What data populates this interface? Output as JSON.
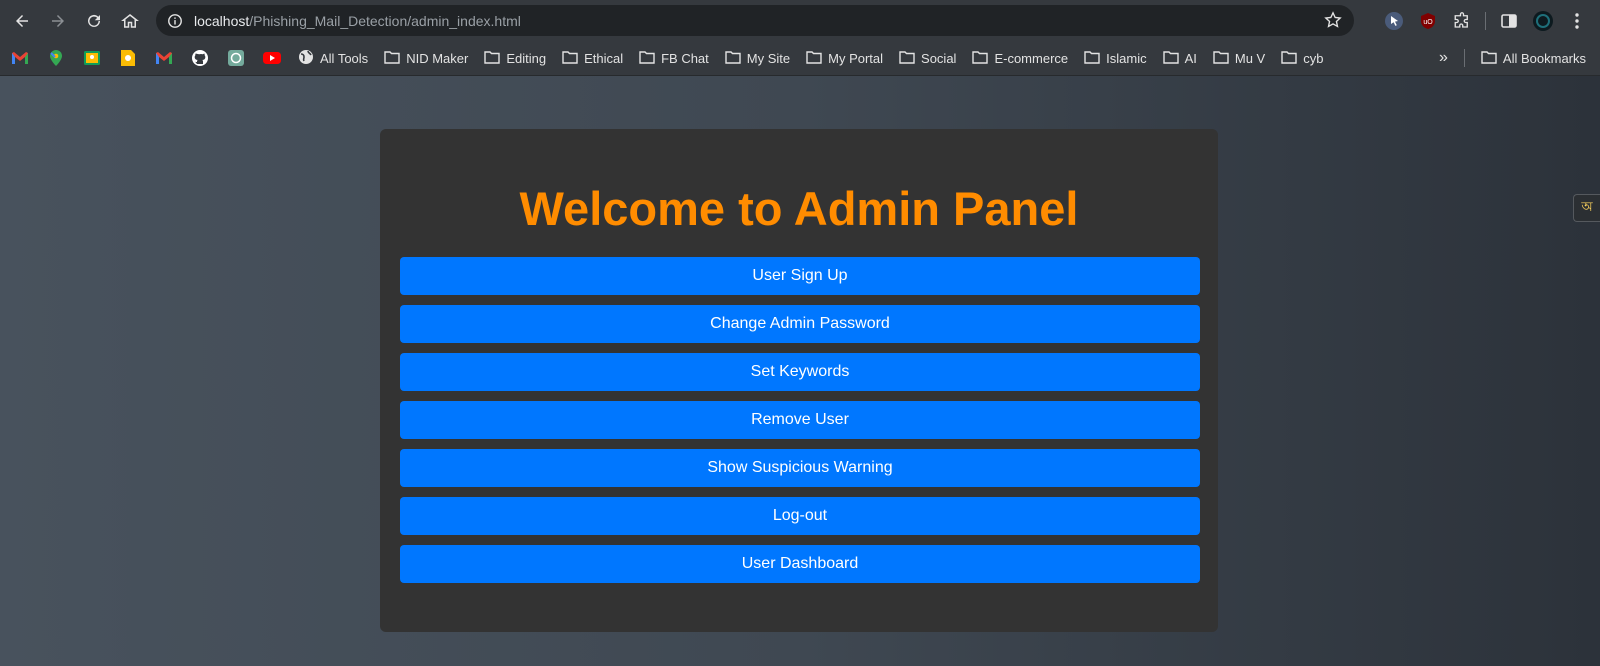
{
  "browser": {
    "url_host": "localhost",
    "url_path": "/Phishing_Mail_Detection/admin_index.html",
    "icons": {
      "back": "back-arrow-icon",
      "forward": "forward-arrow-icon",
      "reload": "reload-icon",
      "home": "home-icon",
      "site_info": "site-info-icon",
      "bookmark_star": "star-icon"
    },
    "extensions": [
      "cursor-extension-icon",
      "ublock-icon",
      "puzzle-extensions-icon",
      "side-panel-icon",
      "profile-avatar-icon",
      "kebab-menu-icon"
    ]
  },
  "bookmarks": {
    "app_icons": [
      "gmail-icon",
      "maps-icon",
      "classroom-icon",
      "keep-icon",
      "gmail-icon",
      "github-icon",
      "chatgpt-icon",
      "youtube-icon"
    ],
    "all_tools": "All Tools",
    "folders": [
      "NID Maker",
      "Editing",
      "Ethical",
      "FB Chat",
      "My Site",
      "My Portal",
      "Social",
      "E-commerce",
      "Islamic",
      "AI",
      "Mu V",
      "cyb"
    ],
    "overflow": "»",
    "all_bookmarks": "All Bookmarks"
  },
  "panel": {
    "title": "Welcome to Admin Panel",
    "buttons": [
      {
        "label": "User Sign Up"
      },
      {
        "label": "Change Admin Password"
      },
      {
        "label": "Set Keywords"
      },
      {
        "label": "Remove User"
      },
      {
        "label": "Show Suspicious Warning"
      },
      {
        "label": "Log-out"
      },
      {
        "label": "User Dashboard"
      }
    ]
  },
  "side_tab": {
    "glyph": "অ"
  },
  "colors": {
    "title": "#ff8c00",
    "button": "#0077ff",
    "panel": "#333333"
  }
}
